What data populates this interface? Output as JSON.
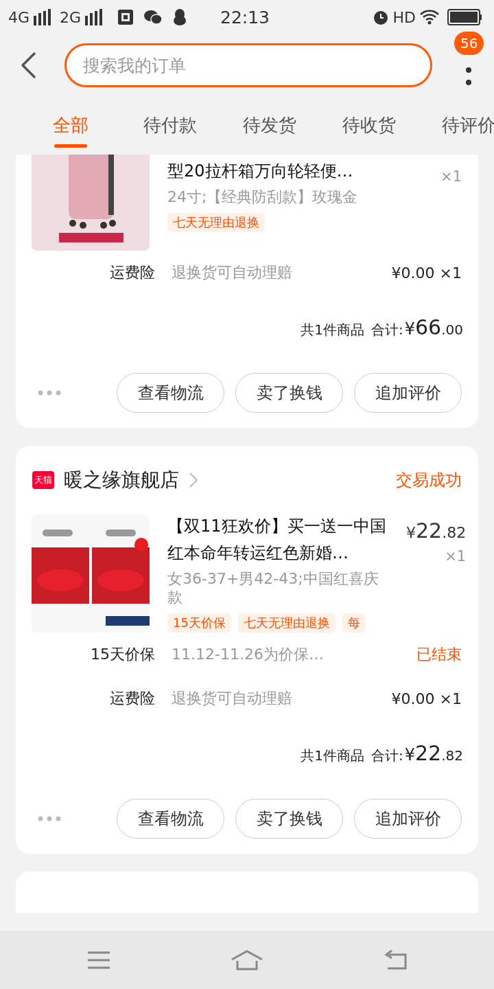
{
  "status_bar": {
    "network_1": "4G",
    "network_2": "2G",
    "time": "22:13",
    "hd": "HD"
  },
  "header": {
    "search": {
      "placeholder": "搜索我的订单"
    },
    "badge": "56"
  },
  "tabs": [
    {
      "label": "全部",
      "selected": true
    },
    {
      "label": "待付款",
      "selected": false
    },
    {
      "label": "待发货",
      "selected": false
    },
    {
      "label": "待收货",
      "selected": false
    },
    {
      "label": "待评价",
      "selected": false
    }
  ],
  "orders": [
    {
      "kind": "order",
      "item": {
        "title": "型20拉杆箱万向轮轻便…",
        "sku": "24寸;【经典防刮款】玫瑰金",
        "qty": "×1",
        "tags": [
          "七天无理由退换"
        ]
      },
      "services": [
        {
          "kind": "price",
          "name": "运费险",
          "desc": "退换货可自动理赔",
          "value": "¥0.00 ×1"
        }
      ],
      "summary": {
        "count": "共1件商品",
        "label": "合计:",
        "currency": "¥",
        "integer": "66",
        "decimal": ".00"
      },
      "buttons": [
        "查看物流",
        "卖了换钱",
        "追加评价"
      ]
    },
    {
      "kind": "order",
      "shop": {
        "badge": "天猫",
        "name": "暖之缘旗舰店",
        "status": "交易成功"
      },
      "item": {
        "title": "【双11狂欢价】买一送一中国红本命年转运红色新婚…",
        "sku": "女36-37+男42-43;中国红喜庆款",
        "price": {
          "currency": "¥",
          "integer": "22",
          "decimal": ".82"
        },
        "qty": "×1",
        "tags": [
          "15天价保",
          "七天无理由退换",
          "每"
        ]
      },
      "services": [
        {
          "kind": "status",
          "name": "15天价保",
          "desc": "11.12-11.26为价保…",
          "value": "已结束"
        },
        {
          "kind": "price",
          "name": "运费险",
          "desc": "退换货可自动理赔",
          "value": "¥0.00 ×1"
        }
      ],
      "summary": {
        "count": "共1件商品",
        "label": "合计:",
        "currency": "¥",
        "integer": "22",
        "decimal": ".82"
      },
      "buttons": [
        "查看物流",
        "卖了换钱",
        "追加评价"
      ]
    },
    {
      "kind": "cut"
    }
  ]
}
